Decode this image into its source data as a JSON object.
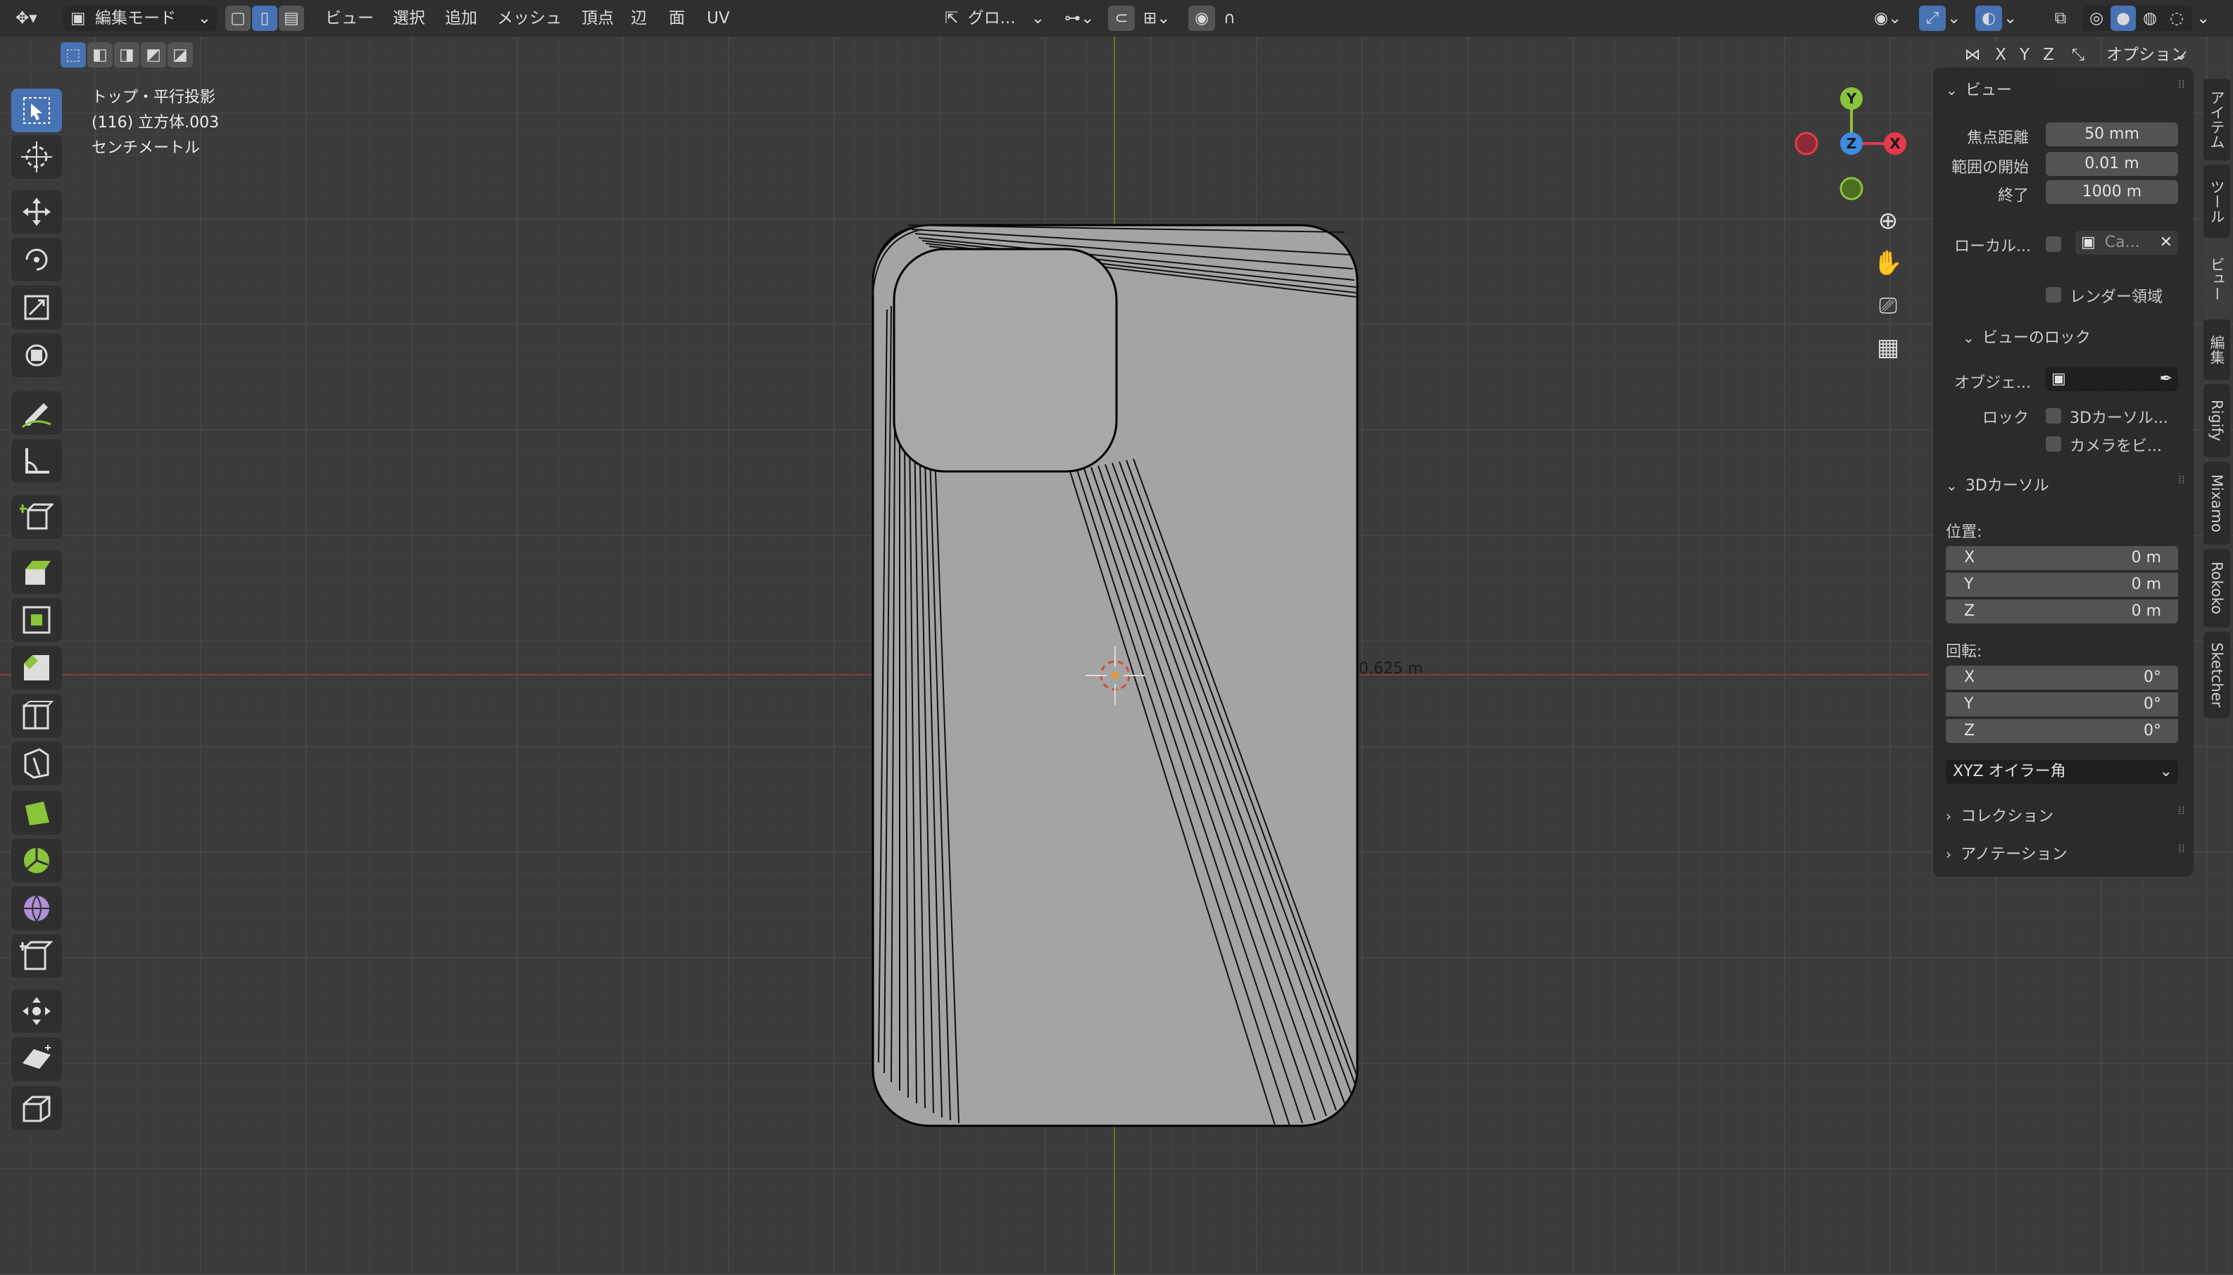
{
  "header": {
    "mode_label": "編集モード",
    "menus": [
      "ビュー",
      "選択",
      "追加",
      "メッシュ",
      "頂点",
      "辺",
      "面",
      "UV"
    ],
    "transform_label": "グロ...",
    "options_label": "オプション",
    "axes": [
      "X",
      "Y",
      "Z"
    ]
  },
  "overlay_info": {
    "view_name": "トップ・平行投影",
    "object_name": "(116) 立方体.003",
    "units": "センチメートル"
  },
  "measurement_label": "0.625 m",
  "gizmo": {
    "x": "X",
    "y": "Y",
    "z": "Z"
  },
  "sidebar": {
    "view_section": {
      "title": "ビュー",
      "focal_label": "焦点距離",
      "focal_value": "50 mm",
      "clip_start_label": "範囲の開始",
      "clip_start_value": "0.01 m",
      "clip_end_label": "終了",
      "clip_end_value": "1000 m",
      "local_camera_label": "ローカル...",
      "local_camera_value": "Ca...",
      "render_region_label": "レンダー領域",
      "view_lock_title": "ビューのロック",
      "lock_object_label": "オブジェ...",
      "lock_label": "ロック",
      "lock_cursor_label": "3Dカーソル...",
      "lock_camera_label": "カメラをビ..."
    },
    "cursor_section": {
      "title": "3Dカーソル",
      "location_label": "位置:",
      "location": [
        {
          "axis": "X",
          "value": "0 m"
        },
        {
          "axis": "Y",
          "value": "0 m"
        },
        {
          "axis": "Z",
          "value": "0 m"
        }
      ],
      "rotation_label": "回転:",
      "rotation": [
        {
          "axis": "X",
          "value": "0°"
        },
        {
          "axis": "Y",
          "value": "0°"
        },
        {
          "axis": "Z",
          "value": "0°"
        }
      ],
      "rotation_mode": "XYZ オイラー角"
    },
    "collection_title": "コレクション",
    "annotation_title": "アノテーション"
  },
  "vertical_tabs": [
    "アイテム",
    "ツール",
    "ビュー",
    "編集",
    "Rigify",
    "Mixamo",
    "Rokoko",
    "Sketcher"
  ],
  "active_vertical_tab": "ビュー",
  "colors": {
    "accent": "#4772b3",
    "x_axis": "#e5394d",
    "y_axis": "#8bc43a",
    "z_axis": "#3e8ae0"
  }
}
